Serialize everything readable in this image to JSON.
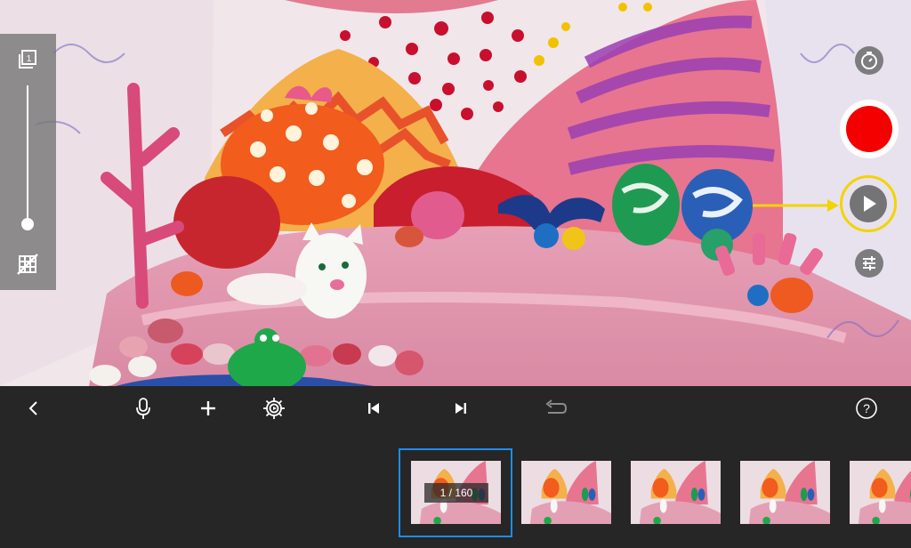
{
  "viewfinder": {
    "description_icon": "camera-viewfinder"
  },
  "left_panel": {
    "top_icon": "onion-skin-icon",
    "top_icon_text": "1",
    "bottom_icon": "grid-off-icon",
    "slider_value": 0.0
  },
  "right_controls": {
    "timer_icon": "timer-icon",
    "record_icon": "record-icon",
    "play_icon": "play-icon",
    "adjust_icon": "adjust-sliders-icon",
    "colors": {
      "record": "#f40000",
      "highlight": "#f2d400"
    }
  },
  "toolbar": {
    "back_icon": "chevron-left-icon",
    "mic_icon": "microphone-icon",
    "add_icon": "plus-icon",
    "settings_icon": "gear-icon",
    "skip_start_icon": "skip-to-start-icon",
    "skip_end_icon": "skip-to-end-icon",
    "undo_icon": "undo-icon",
    "help_icon": "help-icon",
    "help_text": "?"
  },
  "filmstrip": {
    "counter": "1 / 160",
    "selected_border": "#1e8cf0"
  }
}
